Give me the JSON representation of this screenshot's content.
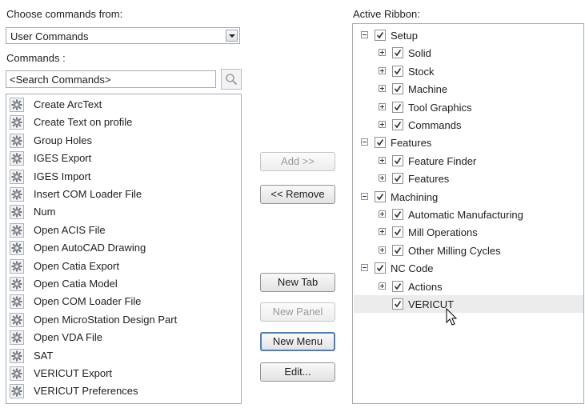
{
  "left": {
    "choose_label": "Choose commands from:",
    "choose_value": "User Commands",
    "commands_label": "Commands :",
    "search_placeholder": "<Search Commands>",
    "commands": [
      "Create ArcText",
      "Create Text on profile",
      "Group Holes",
      "IGES Export",
      "IGES Import",
      "Insert COM Loader File",
      "Num",
      "Open ACIS File",
      "Open AutoCAD Drawing",
      "Open Catia Export",
      "Open Catia Model",
      "Open COM Loader File",
      "Open MicroStation Design Part",
      "Open VDA File",
      "SAT",
      "VERICUT Export",
      "VERICUT Preferences"
    ]
  },
  "buttons": {
    "add": "Add >>",
    "remove": "<< Remove",
    "new_tab": "New Tab",
    "new_panel": "New Panel",
    "new_menu": "New Menu",
    "edit": "Edit..."
  },
  "right": {
    "ribbon_label": "Active Ribbon:",
    "tree": [
      {
        "label": "Setup",
        "level": 0,
        "expander": "minus"
      },
      {
        "label": "Solid",
        "level": 1,
        "expander": "plus"
      },
      {
        "label": "Stock",
        "level": 1,
        "expander": "plus"
      },
      {
        "label": "Machine",
        "level": 1,
        "expander": "plus"
      },
      {
        "label": "Tool Graphics",
        "level": 1,
        "expander": "plus"
      },
      {
        "label": "Commands",
        "level": 1,
        "expander": "plus"
      },
      {
        "label": "Features",
        "level": 0,
        "expander": "minus"
      },
      {
        "label": "Feature Finder",
        "level": 1,
        "expander": "plus"
      },
      {
        "label": "Features",
        "level": 1,
        "expander": "plus"
      },
      {
        "label": "Machining",
        "level": 0,
        "expander": "minus"
      },
      {
        "label": "Automatic Manufacturing",
        "level": 1,
        "expander": "plus"
      },
      {
        "label": "Mill Operations",
        "level": 1,
        "expander": "plus"
      },
      {
        "label": "Other Milling Cycles",
        "level": 1,
        "expander": "plus"
      },
      {
        "label": "NC Code",
        "level": 0,
        "expander": "minus"
      },
      {
        "label": "Actions",
        "level": 1,
        "expander": "plus"
      },
      {
        "label": "VERICUT",
        "level": 1,
        "expander": "none",
        "highlighted": true
      }
    ]
  },
  "icons": {
    "command": "gear-icon",
    "search": "search-icon",
    "dropdown": "chevron-down-icon",
    "check": "check-icon",
    "cursor": "mouse-pointer-icon"
  }
}
